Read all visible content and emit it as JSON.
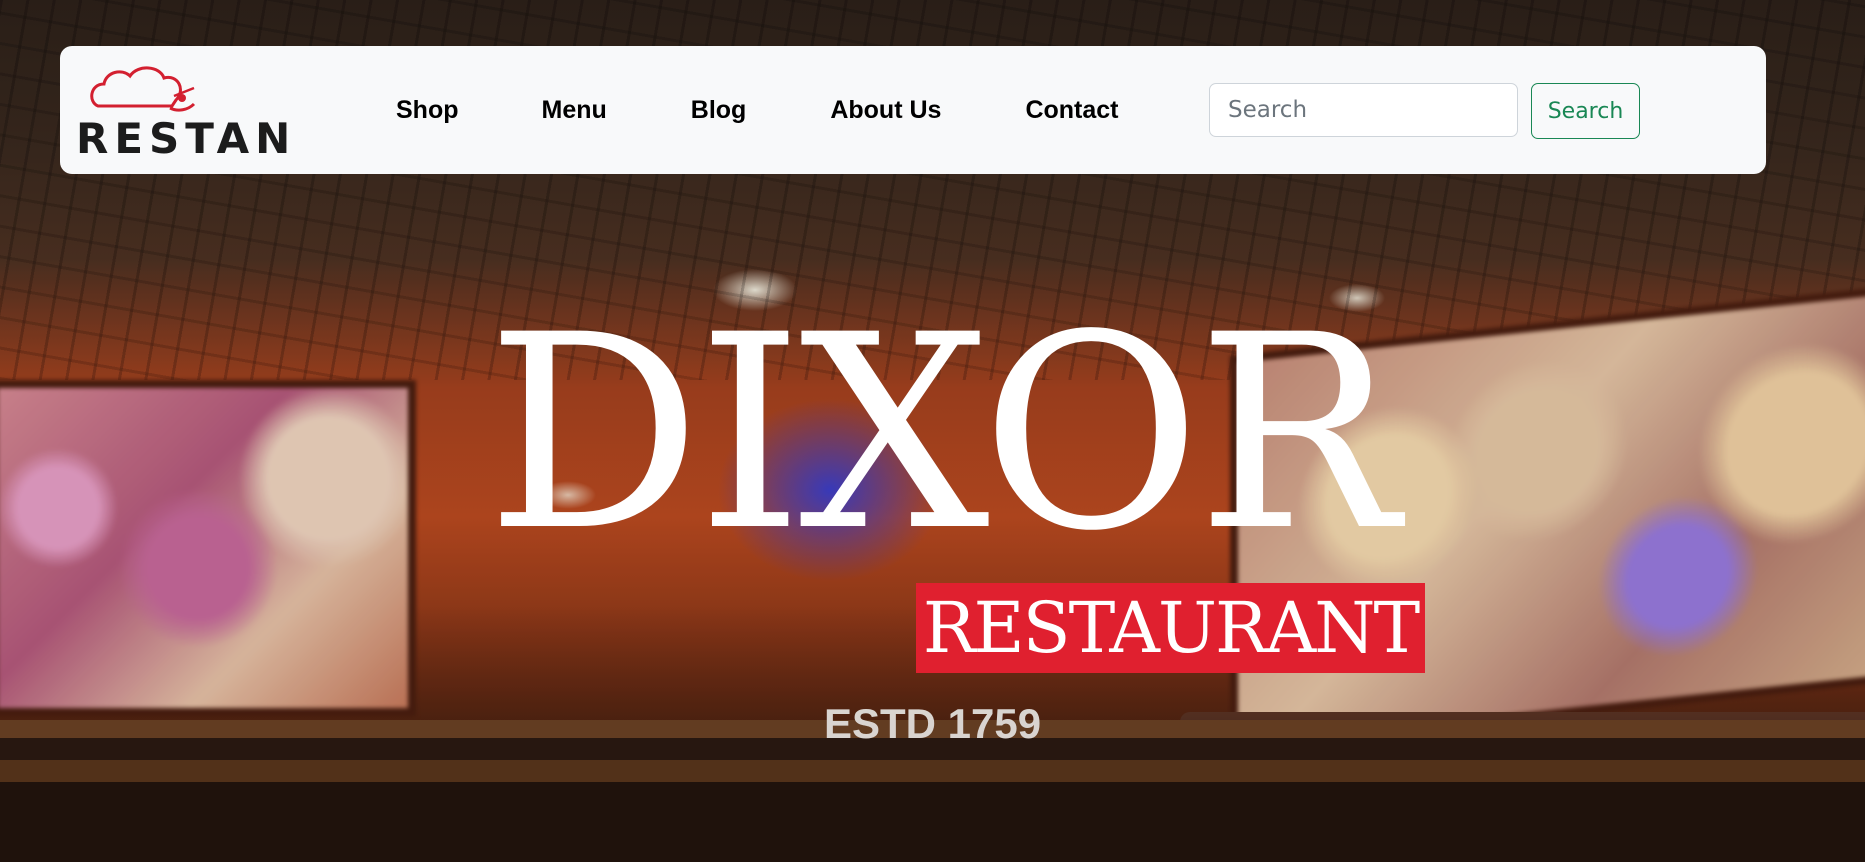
{
  "brand": {
    "logo_text": "RESTAN"
  },
  "nav": {
    "links": [
      {
        "label": "Shop"
      },
      {
        "label": "Menu"
      },
      {
        "label": "Blog"
      },
      {
        "label": "About Us"
      },
      {
        "label": "Contact"
      }
    ]
  },
  "search": {
    "placeholder": "Search",
    "value": "",
    "button_label": "Search"
  },
  "hero": {
    "title": "DIXOR",
    "badge": "RESTAURANT",
    "established": "ESTD 1759"
  },
  "colors": {
    "navbar_bg": "#f8f9fa",
    "search_button": "#198754",
    "badge_bg": "#e0202f",
    "logo_accent": "#d32030"
  }
}
